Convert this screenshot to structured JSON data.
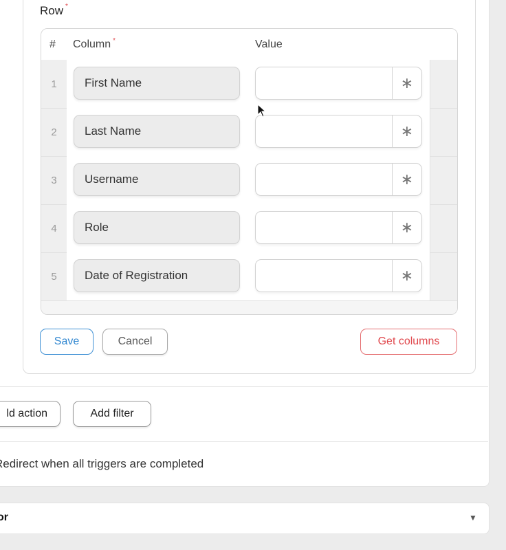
{
  "row_section": {
    "label": "Row",
    "required_mark": "*"
  },
  "table": {
    "headers": {
      "num": "#",
      "column": "Column",
      "column_required": "*",
      "value": "Value"
    },
    "rows": [
      {
        "num": "1",
        "column": "First Name",
        "value": "",
        "value_button": "∗"
      },
      {
        "num": "2",
        "column": "Last Name",
        "value": "",
        "value_button": "∗"
      },
      {
        "num": "3",
        "column": "Username",
        "value": "",
        "value_button": "∗"
      },
      {
        "num": "4",
        "column": "Role",
        "value": "",
        "value_button": "∗"
      },
      {
        "num": "5",
        "column": "Date of Registration",
        "value": "",
        "value_button": "∗"
      }
    ]
  },
  "actions": {
    "save": "Save",
    "cancel": "Cancel",
    "get_columns": "Get columns"
  },
  "toolbar": {
    "add_action": "ld action",
    "add_filter": "Add filter"
  },
  "redirect_text": "Redirect when all triggers are completed",
  "bottom_select": {
    "label": "or",
    "caret_icon": "caret-down-icon"
  },
  "colors": {
    "primary": "#2f86d0",
    "danger": "#e0474c",
    "required": "#e0474c"
  }
}
